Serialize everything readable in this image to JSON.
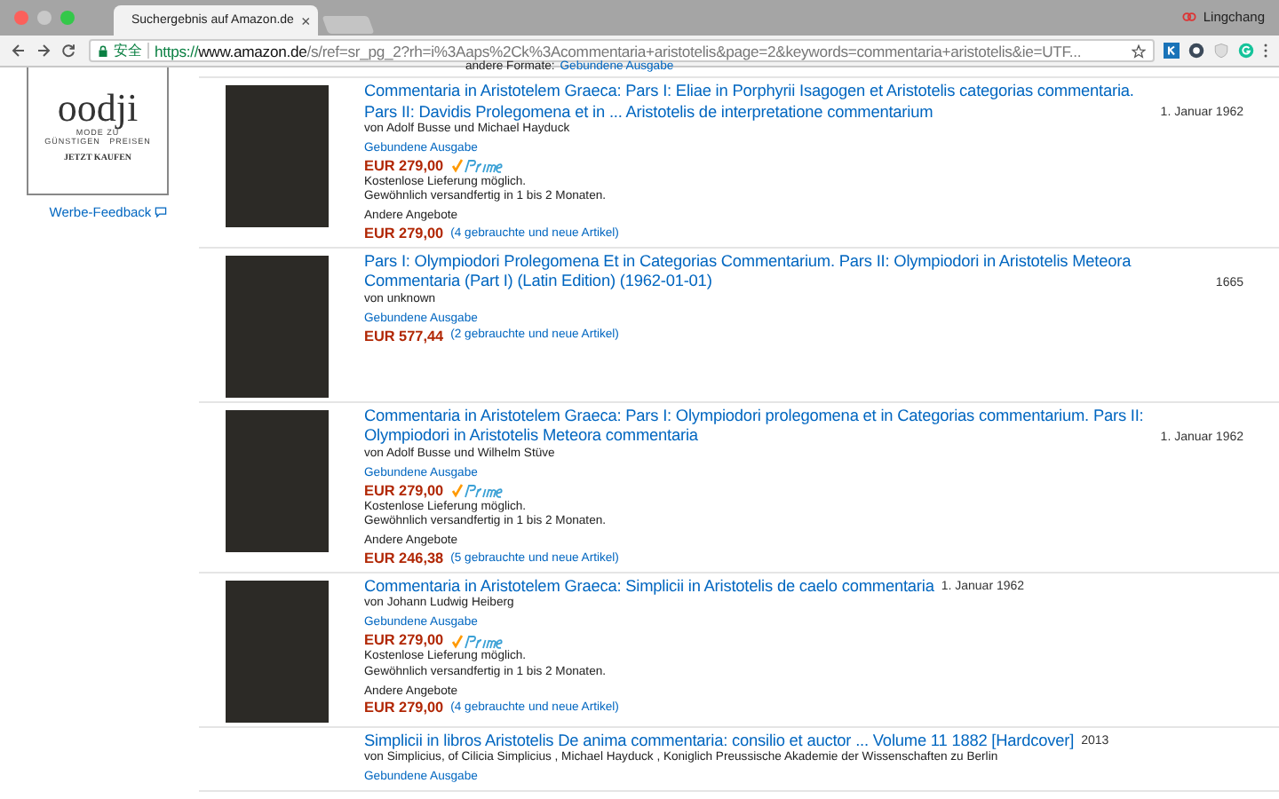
{
  "window": {
    "tab_title": "Suchergebnis auf Amazon.de",
    "tab_close": "×",
    "user": "Lingchang"
  },
  "address_bar": {
    "secure_label": "安全",
    "scheme": "https://",
    "host": "www.amazon.de",
    "path": "/s/ref=sr_pg_2?rh=i%3Aaps%2Ck%3Acommentaria+aristotelis&page=2&keywords=commentaria+aristotelis&ie=UTF..."
  },
  "ad": {
    "brand": "oodji",
    "tagline_1": "MODE ZU",
    "tagline_2": "GÜNSTIGEN   PREISEN",
    "cta": "JETZT KAUFEN",
    "feedback": "Werbe-Feedback"
  },
  "top_partial": {
    "label": "andere Formate:",
    "link": "Gebundene Ausgabe"
  },
  "results": [
    {
      "title": "Commentaria in Aristotelem Graeca: Pars I: Eliae in Porphyrii Isagogen et Aristotelis categorias commentaria. Pars II: Davidis Prolegomena et in ... Aristotelis de interpretatione commentarium",
      "date": "1. Januar 1962",
      "author": "von Adolf Busse und Michael Hayduck",
      "format": "Gebundene Ausgabe",
      "price": "EUR 279,00",
      "prime": true,
      "shipping": [
        "Kostenlose Lieferung möglich.",
        "Gewöhnlich versandfertig in 1 bis 2 Monaten."
      ],
      "others_label": "Andere Angebote",
      "others_price": "EUR 279,00",
      "others_link": "(4 gebrauchte und neue Artikel)"
    },
    {
      "title": "Pars I: Olympiodori Prolegomena Et in Categorias Commentarium. Pars II: Olympiodori in Aristotelis Meteora Commentaria (Part I) (Latin Edition) (1962-01-01)",
      "date": "1665",
      "author": "von unknown",
      "format": "Gebundene Ausgabe",
      "price": "EUR 577,44",
      "price_link": "(2 gebrauchte und neue Artikel)"
    },
    {
      "title": "Commentaria in Aristotelem Graeca: Pars I: Olympiodori prolegomena et in Categorias commentarium. Pars II: Olympiodori in Aristotelis Meteora commentaria",
      "date": "1. Januar 1962",
      "author": "von Adolf Busse und Wilhelm Stüve",
      "format": "Gebundene Ausgabe",
      "price": "EUR 279,00",
      "prime": true,
      "shipping": [
        "Kostenlose Lieferung möglich.",
        "Gewöhnlich versandfertig in 1 bis 2 Monaten."
      ],
      "others_label": "Andere Angebote",
      "others_price": "EUR 246,38",
      "others_link": "(5 gebrauchte und neue Artikel)"
    },
    {
      "title": "Commentaria in Aristotelem Graeca: Simplicii in Aristotelis de caelo commentaria",
      "date": "1. Januar 1962",
      "author": "von Johann Ludwig Heiberg",
      "format": "Gebundene Ausgabe",
      "price": "EUR 279,00",
      "prime": true,
      "shipping": [
        "Kostenlose Lieferung möglich.",
        "Gewöhnlich versandfertig in 1 bis 2 Monaten."
      ],
      "others_label": "Andere Angebote",
      "others_price": "EUR 279,00",
      "others_link": "(4 gebrauchte und neue Artikel)"
    },
    {
      "title": "Simplicii in libros Aristotelis De anima commentaria: consilio et auctor ... Volume 11 1882 [Hardcover]",
      "date": "2013",
      "author": "von Simplicius, of Cilicia Simplicius , Michael Hayduck , Koniglich Preussische Akademie der Wissenschaften zu Berlin",
      "format": "Gebundene Ausgabe",
      "no_cover": true
    }
  ]
}
